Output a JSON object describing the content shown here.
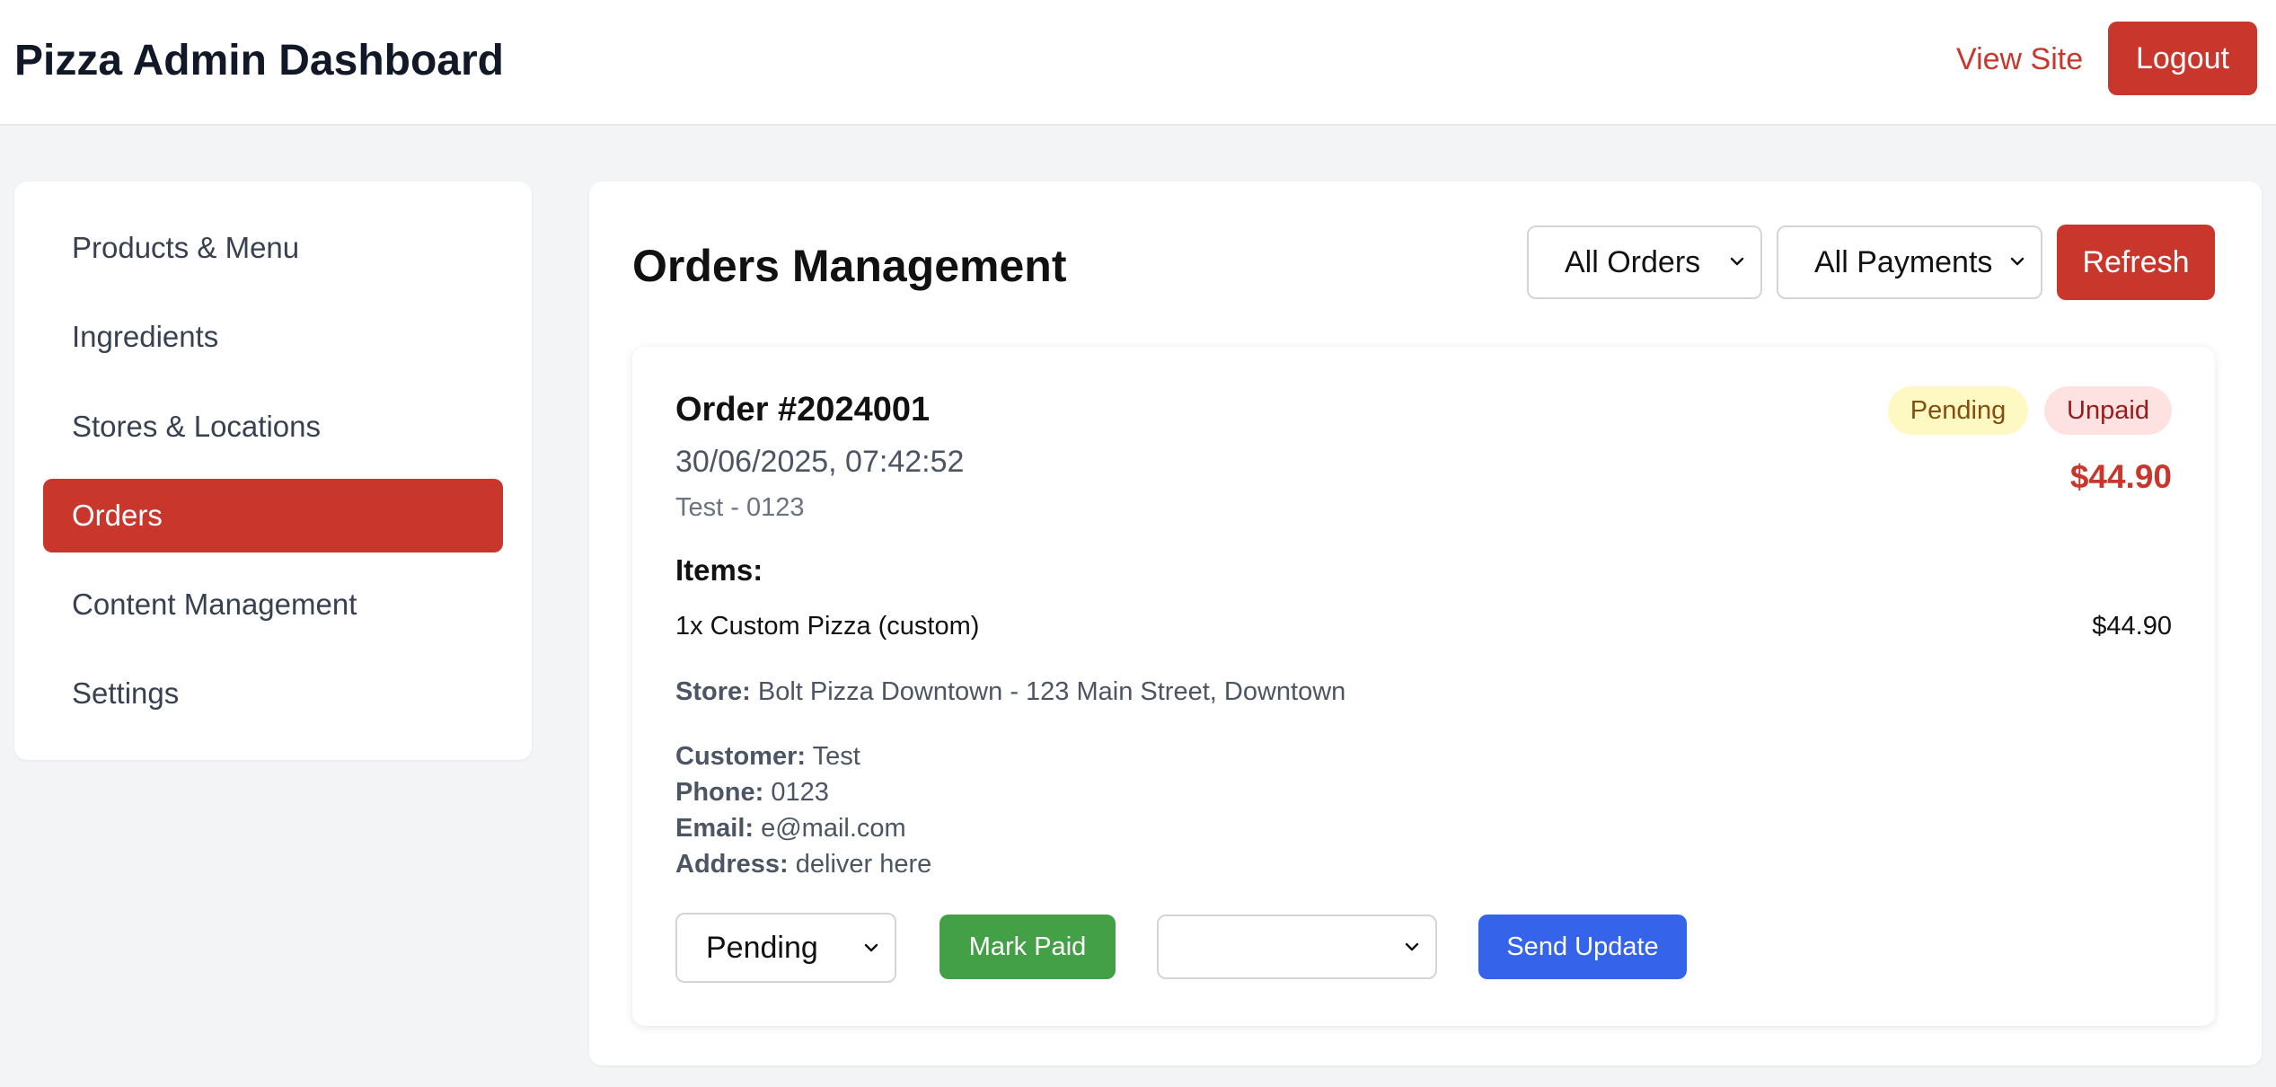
{
  "header": {
    "title": "Pizza Admin Dashboard",
    "view_site": "View Site",
    "logout": "Logout"
  },
  "sidebar": {
    "items": [
      {
        "label": "Products & Menu",
        "active": false
      },
      {
        "label": "Ingredients",
        "active": false
      },
      {
        "label": "Stores & Locations",
        "active": false
      },
      {
        "label": "Orders",
        "active": true
      },
      {
        "label": "Content Management",
        "active": false
      },
      {
        "label": "Settings",
        "active": false
      }
    ]
  },
  "main": {
    "title": "Orders Management",
    "filters": {
      "status_selected": "All Orders",
      "payment_selected": "All Payments"
    },
    "refresh": "Refresh"
  },
  "order": {
    "id": "Order #2024001",
    "datetime": "30/06/2025, 07:42:52",
    "subtitle": "Test - 0123",
    "status_badge": "Pending",
    "payment_badge": "Unpaid",
    "total": "$44.90",
    "items_label": "Items:",
    "items": [
      {
        "description": "1x Custom Pizza (custom)",
        "price": "$44.90"
      }
    ],
    "store_label": "Store:",
    "store": "Bolt Pizza Downtown - 123 Main Street, Downtown",
    "customer_label": "Customer:",
    "customer": "Test",
    "phone_label": "Phone:",
    "phone": "0123",
    "email_label": "Email:",
    "email": "e@mail.com",
    "address_label": "Address:",
    "address": "deliver here",
    "controls": {
      "status_selected": "Pending",
      "mark_paid": "Mark Paid",
      "update_selected": "",
      "send_update": "Send Update"
    }
  },
  "colors": {
    "accent": "#c9372c",
    "success": "#43a047",
    "primary_blue": "#3563e9",
    "pending_bg": "#fef9c3",
    "unpaid_bg": "#fee2e2"
  }
}
